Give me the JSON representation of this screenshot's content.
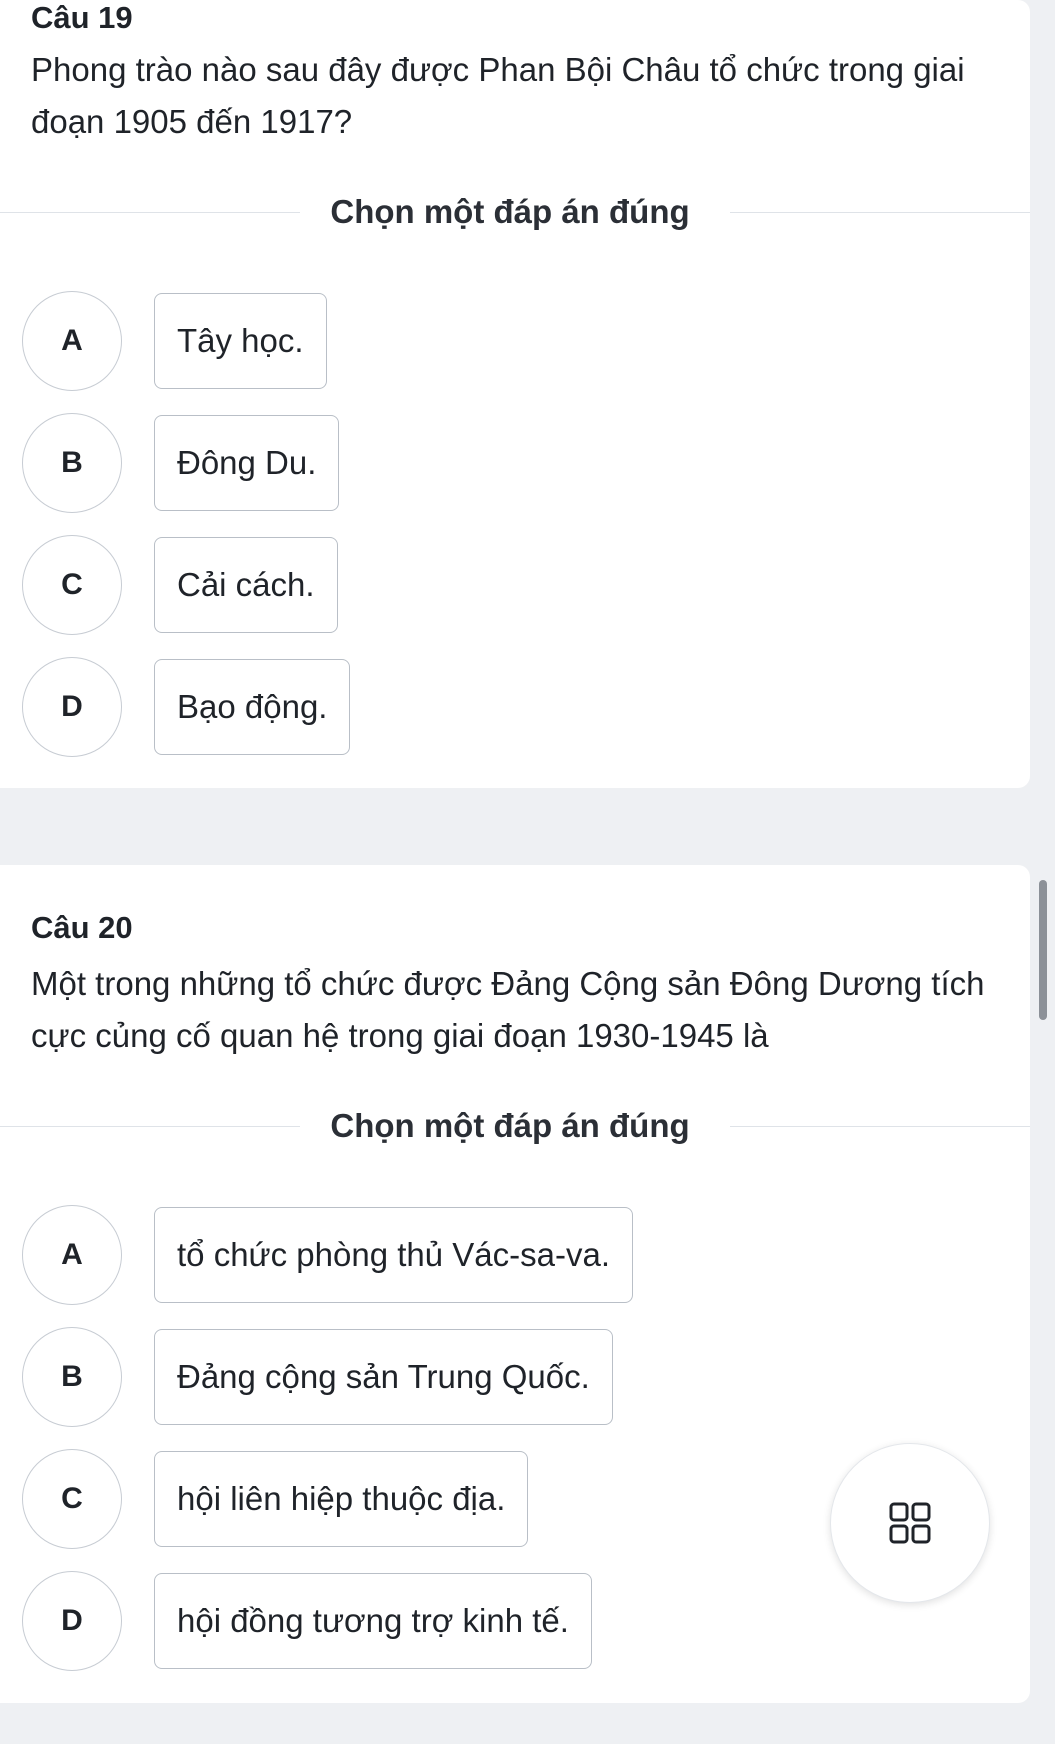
{
  "questions": [
    {
      "number": "Câu 19",
      "text": "Phong trào nào sau đây được Phan Bội Châu tổ chức trong giai đoạn 1905 đến 1917?",
      "instruction": "Chọn một đáp án đúng",
      "options": [
        {
          "letter": "A",
          "text": "Tây học."
        },
        {
          "letter": "B",
          "text": "Đông Du."
        },
        {
          "letter": "C",
          "text": "Cải cách."
        },
        {
          "letter": "D",
          "text": "Bạo động."
        }
      ]
    },
    {
      "number": "Câu 20",
      "text": "Một trong những tổ chức được Đảng Cộng sản Đông Dương tích cực củng cố quan hệ trong giai đoạn 1930-1945 là",
      "instruction": "Chọn một đáp án đúng",
      "options": [
        {
          "letter": "A",
          "text": "tổ chức phòng thủ Vác-sa-va."
        },
        {
          "letter": "B",
          "text": "Đảng cộng sản Trung Quốc."
        },
        {
          "letter": "C",
          "text": "hội liên hiệp thuộc địa."
        },
        {
          "letter": "D",
          "text": "hội đồng tương trợ kinh tế."
        }
      ]
    }
  ],
  "floating_button": {
    "icon": "grid-icon"
  }
}
